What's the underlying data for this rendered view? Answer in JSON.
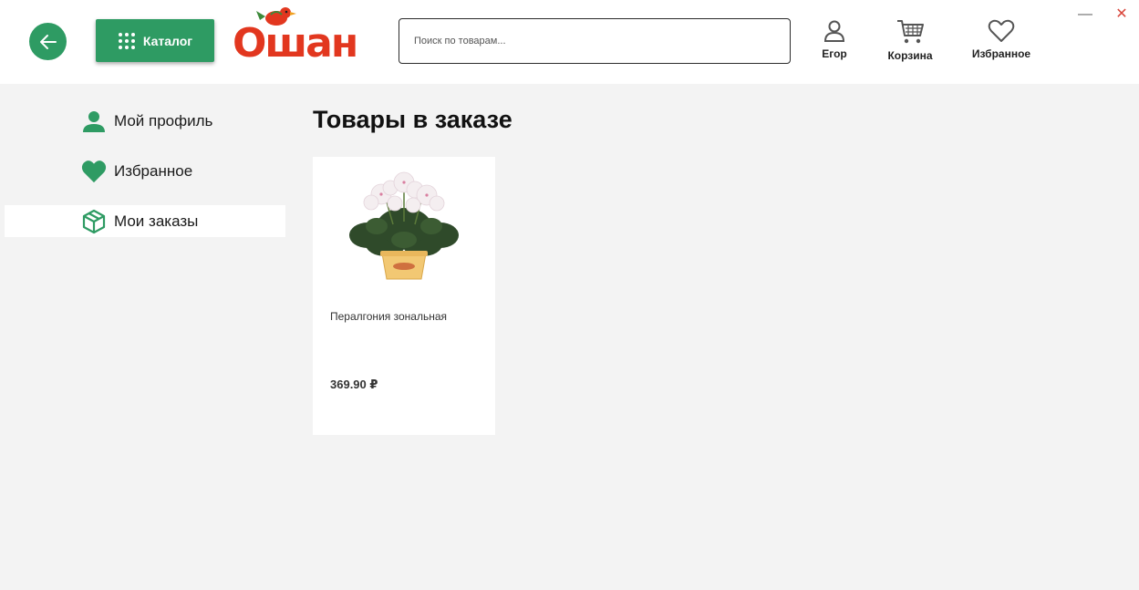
{
  "header": {
    "catalog_label": "Каталог",
    "logo_text": "Ошан",
    "search_placeholder": "Поиск по товарам...",
    "user_label": "Егор",
    "cart_label": "Корзина",
    "favorites_label": "Избранное",
    "minimize_symbol": "—",
    "close_symbol": "✕"
  },
  "sidebar": {
    "items": [
      {
        "label": "Мой профиль",
        "icon": "user-icon",
        "active": false
      },
      {
        "label": "Избранное",
        "icon": "heart-icon",
        "active": false
      },
      {
        "label": "Мои заказы",
        "icon": "box-icon",
        "active": true
      }
    ]
  },
  "main": {
    "title": "Товары в заказе",
    "products": [
      {
        "name": "Пералгония зональная",
        "price": "369.90 ₽"
      }
    ]
  },
  "colors": {
    "accent": "#2e9b63",
    "logo_red": "#e2371f",
    "background": "#f3f3f3"
  }
}
